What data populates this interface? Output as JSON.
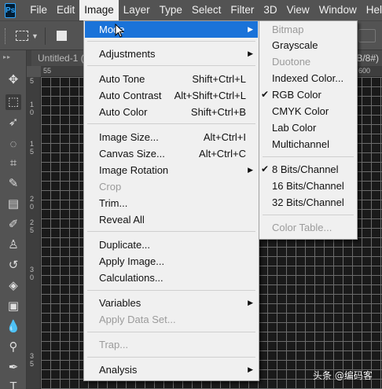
{
  "app": {
    "logo": "Ps"
  },
  "menubar": [
    "File",
    "Edit",
    "Image",
    "Layer",
    "Type",
    "Select",
    "Filter",
    "3D",
    "View",
    "Window",
    "Help"
  ],
  "document": {
    "tab_title": "Untitled-1 (",
    "tab_right": "B/8#)",
    "ruler_h": [
      "55",
      "600"
    ],
    "ruler_v": [
      "5",
      "1",
      "0",
      "1",
      "5",
      "2",
      "0",
      "2",
      "5",
      "3",
      "0",
      "3",
      "5"
    ]
  },
  "image_menu": {
    "mode": "Mode",
    "adjustments": "Adjustments",
    "auto_tone": "Auto Tone",
    "auto_tone_sc": "Shift+Ctrl+L",
    "auto_contrast": "Auto Contrast",
    "auto_contrast_sc": "Alt+Shift+Ctrl+L",
    "auto_color": "Auto Color",
    "auto_color_sc": "Shift+Ctrl+B",
    "image_size": "Image Size...",
    "image_size_sc": "Alt+Ctrl+I",
    "canvas_size": "Canvas Size...",
    "canvas_size_sc": "Alt+Ctrl+C",
    "image_rotation": "Image Rotation",
    "crop": "Crop",
    "trim": "Trim...",
    "reveal_all": "Reveal All",
    "duplicate": "Duplicate...",
    "apply_image": "Apply Image...",
    "calculations": "Calculations...",
    "variables": "Variables",
    "apply_data_set": "Apply Data Set...",
    "trap": "Trap...",
    "analysis": "Analysis"
  },
  "mode_menu": {
    "bitmap": "Bitmap",
    "grayscale": "Grayscale",
    "duotone": "Duotone",
    "indexed_color": "Indexed Color...",
    "rgb_color": "RGB Color",
    "cmyk_color": "CMYK Color",
    "lab_color": "Lab Color",
    "multichannel": "Multichannel",
    "bits8": "8 Bits/Channel",
    "bits16": "16 Bits/Channel",
    "bits32": "32 Bits/Channel",
    "color_table": "Color Table..."
  },
  "watermark": "头条 @编码客",
  "colors": {
    "highlight": "#1a73d9",
    "menu_bg": "#f0f0f0",
    "ui_bg": "#535353"
  }
}
